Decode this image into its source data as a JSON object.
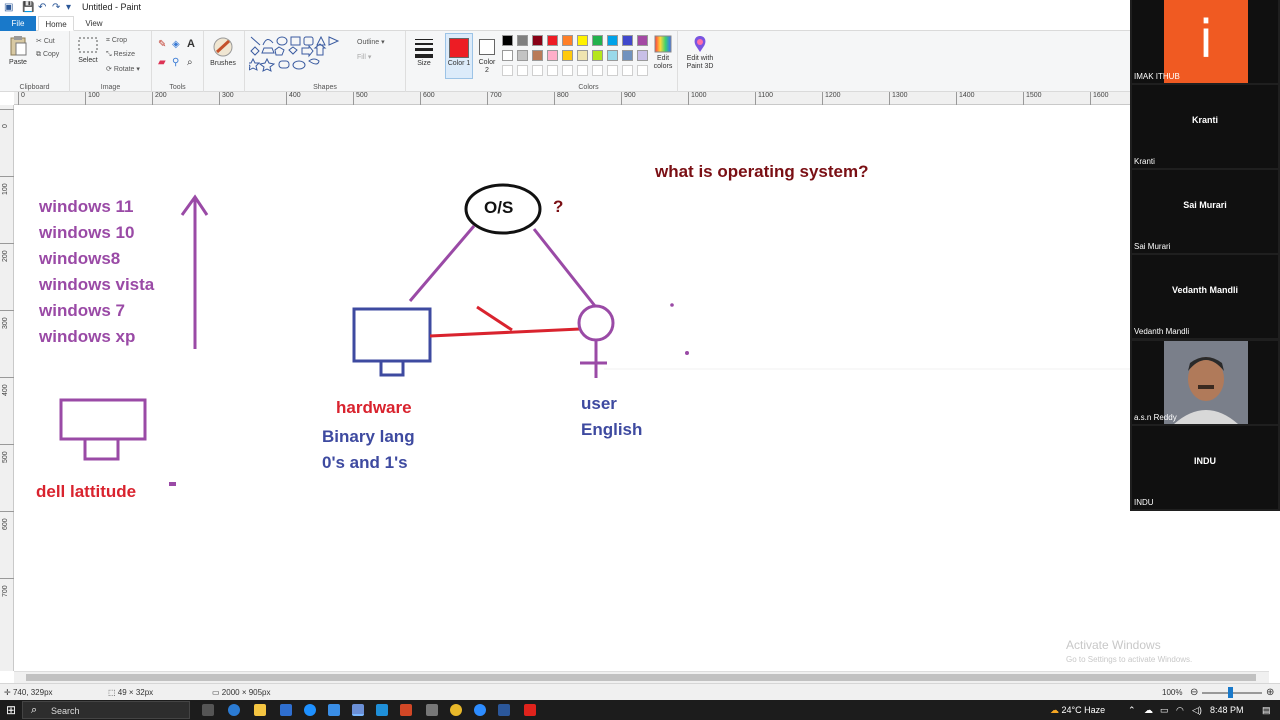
{
  "window": {
    "title": "Untitled - Paint"
  },
  "tabs": {
    "file": "File",
    "home": "Home",
    "view": "View"
  },
  "ribbon": {
    "clipboard": {
      "label": "Clipboard",
      "paste": "Paste",
      "cut": "Cut",
      "copy": "Copy"
    },
    "image": {
      "label": "Image",
      "select": "Select",
      "crop": "Crop",
      "resize": "Resize",
      "rotate": "Rotate"
    },
    "tools": {
      "label": "Tools",
      "brushes": "Brushes"
    },
    "shapes": {
      "label": "Shapes",
      "outline": "Outline",
      "fill": "Fill"
    },
    "size": "Size",
    "color1": "Color 1",
    "color2": "Color 2",
    "colors": {
      "label": "Colors",
      "edit": "Edit colors",
      "paint3d": "Edit with Paint 3D"
    },
    "palette": [
      "#000000",
      "#7f7f7f",
      "#880015",
      "#ed1c24",
      "#ff7f27",
      "#fff200",
      "#22b14c",
      "#00a2e8",
      "#3f48cc",
      "#a349a4",
      "#ffffff",
      "#c3c3c3",
      "#b97a57",
      "#ffaec9",
      "#ffc90e",
      "#efe4b0",
      "#b5e61d",
      "#99d9ea",
      "#7092be",
      "#c8bfe7"
    ],
    "color1_value": "#ed1c24",
    "color2_value": "#ffffff"
  },
  "ruler": {
    "h": [
      "0",
      "100",
      "200",
      "300",
      "400",
      "500",
      "600",
      "700",
      "800",
      "900",
      "1000",
      "1100",
      "1200",
      "1300",
      "1400",
      "1500",
      "1600"
    ],
    "v": [
      "0",
      "100",
      "200",
      "300",
      "400",
      "500",
      "600",
      "700"
    ]
  },
  "canvas": {
    "windows_list": [
      "windows 11",
      "windows 10",
      "windows8",
      "windows vista",
      "windows 7",
      "windows xp"
    ],
    "os_label": "O/S",
    "question_mark": "?",
    "heading": "what is operating system?",
    "hardware": "hardware",
    "binary_lang": "Binary lang",
    "zeros_ones": "0's and 1's",
    "user": "user",
    "english": "English",
    "dell": "dell lattitude"
  },
  "status": {
    "cursor": "740, 329px",
    "selection": "49 × 32px",
    "canvas_size": "2000 × 905px",
    "zoom": "100%"
  },
  "watermark": {
    "line1": "Activate Windows",
    "line2": "Go to Settings to activate Windows."
  },
  "participants": [
    {
      "name": "IMAK ITHUB",
      "center": ""
    },
    {
      "name": "Kranti",
      "center": "Kranti"
    },
    {
      "name": "Sai Murari",
      "center": "Sai Murari"
    },
    {
      "name": "Vedanth Mandli",
      "center": "Vedanth Mandli"
    },
    {
      "name": "a.s.n Reddy",
      "center": ""
    },
    {
      "name": "INDU",
      "center": "INDU"
    }
  ],
  "taskbar": {
    "search": "Search",
    "weather": "24°C  Haze",
    "time": "8:48 PM"
  }
}
